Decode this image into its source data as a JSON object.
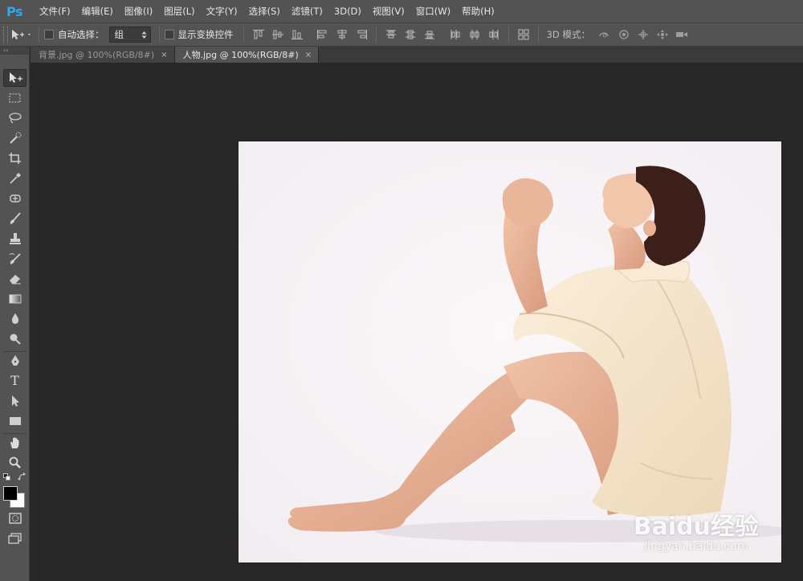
{
  "app": {
    "logo_text": "Ps",
    "accent_color": "#2fa6f2"
  },
  "menu": [
    {
      "label": "文件(F)"
    },
    {
      "label": "编辑(E)"
    },
    {
      "label": "图像(I)"
    },
    {
      "label": "图层(L)"
    },
    {
      "label": "文字(Y)"
    },
    {
      "label": "选择(S)"
    },
    {
      "label": "滤镜(T)"
    },
    {
      "label": "3D(D)"
    },
    {
      "label": "视图(V)"
    },
    {
      "label": "窗口(W)"
    },
    {
      "label": "帮助(H)"
    }
  ],
  "options": {
    "auto_select_label": "自动选择：",
    "auto_select_checked": false,
    "auto_select_value": "组",
    "show_transform_label": "显示变换控件",
    "show_transform_checked": false,
    "mode_3d_label": "3D 模式："
  },
  "toolbar": {
    "collapse_glyph": "››",
    "tools": [
      {
        "name": "move-tool",
        "icon": "move-icon",
        "active": true
      },
      {
        "name": "marquee-tool",
        "icon": "rect-marquee-icon"
      },
      {
        "name": "lasso-tool",
        "icon": "lasso-icon"
      },
      {
        "name": "quick-select-tool",
        "icon": "quick-select-icon"
      },
      {
        "name": "crop-tool",
        "icon": "crop-icon"
      },
      {
        "name": "eyedropper-tool",
        "icon": "eyedropper-icon"
      },
      {
        "name": "healing-tool",
        "icon": "healing-brush-icon"
      },
      {
        "name": "brush-tool",
        "icon": "brush-icon"
      },
      {
        "name": "stamp-tool",
        "icon": "clone-stamp-icon"
      },
      {
        "name": "history-brush-tool",
        "icon": "history-brush-icon"
      },
      {
        "name": "eraser-tool",
        "icon": "eraser-icon"
      },
      {
        "name": "gradient-tool",
        "icon": "gradient-icon"
      },
      {
        "name": "blur-tool",
        "icon": "blur-drop-icon"
      },
      {
        "name": "dodge-tool",
        "icon": "dodge-icon"
      },
      {
        "name": "pen-tool",
        "icon": "pen-icon"
      },
      {
        "name": "type-tool",
        "icon": "type-icon",
        "glyph": "T"
      },
      {
        "name": "path-select-tool",
        "icon": "path-select-icon"
      },
      {
        "name": "shape-tool",
        "icon": "rectangle-icon"
      },
      {
        "name": "hand-tool",
        "icon": "hand-icon"
      },
      {
        "name": "zoom-tool",
        "icon": "zoom-icon"
      }
    ],
    "foreground_color": "#000000",
    "background_color": "#ffffff"
  },
  "tabs": [
    {
      "label": "背景.jpg @ 100%(RGB/8#)",
      "active": false
    },
    {
      "label": "人物.jpg @ 100%(RGB/8#)",
      "active": true
    }
  ],
  "tab_close_glyph": "×",
  "document": {
    "background_color": "#f6f1f4",
    "watermark_brand": "Baidu经验",
    "watermark_url": "jingyan.baidu.com"
  }
}
